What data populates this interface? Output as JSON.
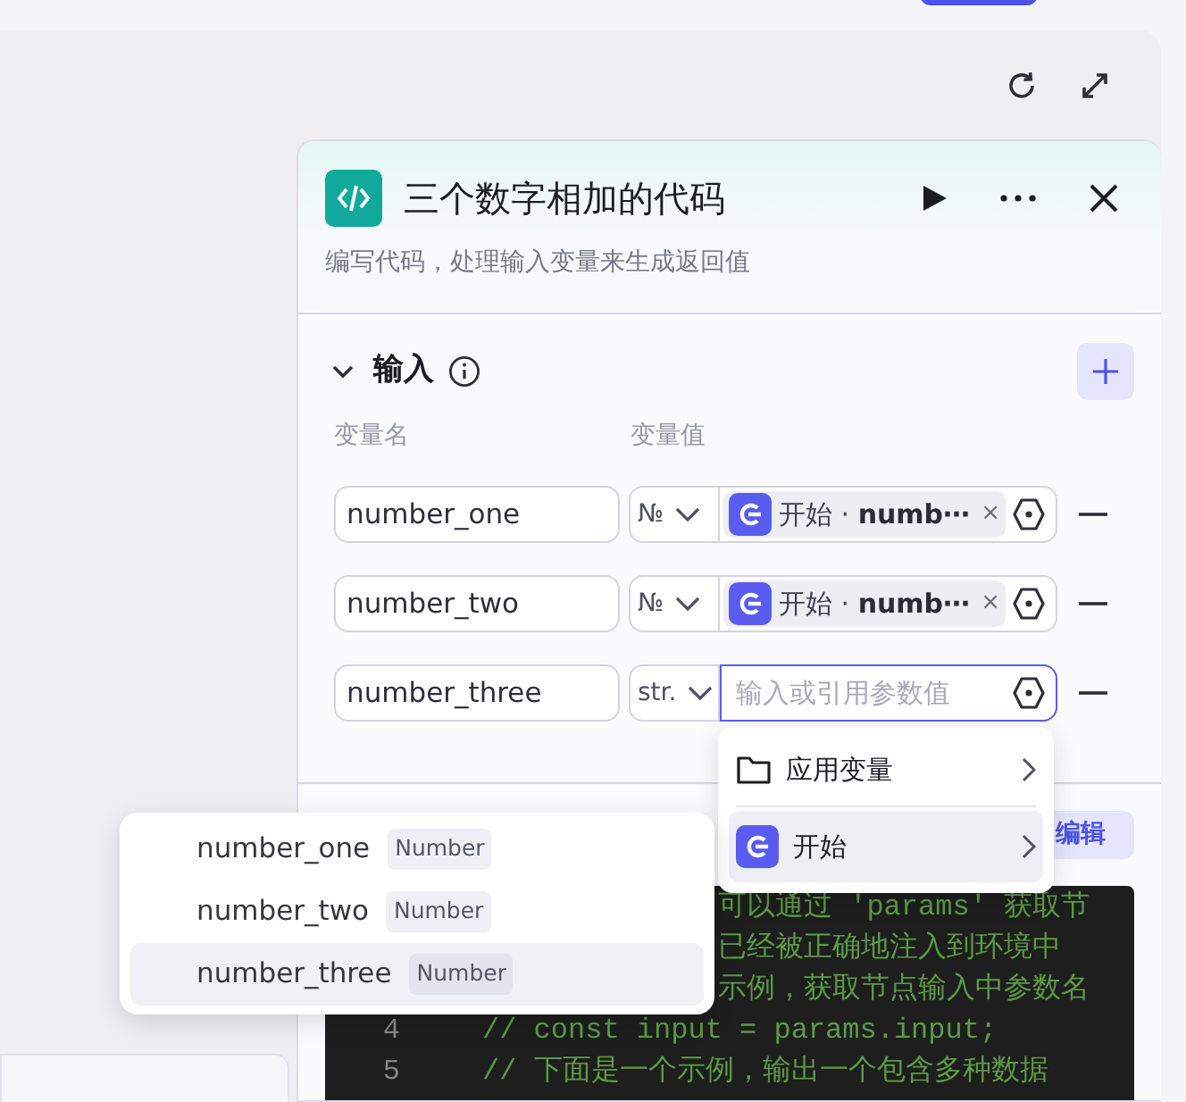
{
  "node": {
    "title": "三个数字相加的代码",
    "description": "编写代码，处理输入变量来生成返回值"
  },
  "inputs": {
    "title": "输入",
    "expanded": true,
    "columns": [
      "变量名",
      "变量值"
    ],
    "rows": [
      {
        "name": "number_one",
        "type": "№",
        "focused": false,
        "value": {
          "kind": "reference",
          "source": "开始",
          "separator": "·",
          "variable": "numb⋯",
          "clear": "×"
        }
      },
      {
        "name": "number_two",
        "type": "№",
        "focused": false,
        "value": {
          "kind": "reference",
          "source": "开始",
          "separator": "·",
          "variable": "numb⋯",
          "clear": "×"
        }
      },
      {
        "name": "number_three",
        "type": "str.",
        "focused": true,
        "value": {
          "kind": "empty",
          "placeholder": "输入或引用参数值"
        }
      }
    ]
  },
  "edit_button": "编辑",
  "code_lines": [
    {
      "kind": "covered",
      "text": "可以通过 'params'  获取节"
    },
    {
      "kind": "covered",
      "text": "已经被正确地注入到环境中"
    },
    {
      "kind": "covered",
      "text": "示例，获取节点输入中参数名"
    },
    {
      "kind": "full",
      "number": "4",
      "text": "// const input = params.input;"
    },
    {
      "kind": "full",
      "number": "5",
      "text": "// 下面是一个示例，输出一个包含多种数据"
    }
  ],
  "reference_menu": [
    {
      "kind": "folder",
      "label": "应用变量",
      "selected": false
    },
    {
      "kind": "node",
      "label": "开始",
      "selected": true
    }
  ],
  "variable_menu": [
    {
      "name": "number_one",
      "type": "Number",
      "selected": false
    },
    {
      "name": "number_two",
      "type": "Number",
      "selected": false
    },
    {
      "name": "number_three",
      "type": "Number",
      "selected": true
    }
  ]
}
